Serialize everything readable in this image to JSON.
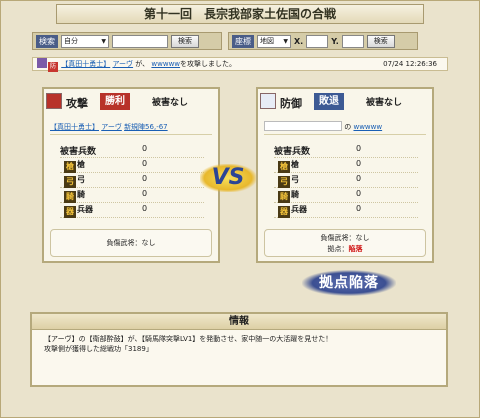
{
  "title": "第十一回　長宗我部家土佐国の合戦",
  "search_left": {
    "label": "検索",
    "select": "自分",
    "button": "検索"
  },
  "search_right": {
    "label": "座標",
    "select": "地図",
    "x_label": "X.",
    "y_label": "Y.",
    "button": "検索"
  },
  "report": {
    "badge": "防",
    "unit_tag": "【真田十勇士】",
    "player": "アーヴ",
    "particle": "が、",
    "target": "wwwww",
    "message": "を攻撃しました。",
    "time": "07/24 12:26:36"
  },
  "attack": {
    "label": "攻撃",
    "result": "勝利",
    "damage": "被害なし",
    "unit_tag": "【真田十勇士】",
    "player": "アーヴ",
    "location": "新規陣56,-67",
    "header": "被害兵数",
    "header_value": "0",
    "rows": [
      {
        "icon": "槍",
        "label": "槍",
        "value": "0"
      },
      {
        "icon": "弓",
        "label": "弓",
        "value": "0"
      },
      {
        "icon": "騎",
        "label": "騎",
        "value": "0"
      },
      {
        "icon": "器",
        "label": "兵器",
        "value": "0"
      }
    ],
    "wounded": "負傷武将：なし"
  },
  "defense": {
    "label": "防御",
    "result": "敗退",
    "damage": "被害なし",
    "particle": "の",
    "player": "wwwww",
    "header": "被害兵数",
    "header_value": "0",
    "rows": [
      {
        "icon": "槍",
        "label": "槍",
        "value": "0"
      },
      {
        "icon": "弓",
        "label": "弓",
        "value": "0"
      },
      {
        "icon": "騎",
        "label": "騎",
        "value": "0"
      },
      {
        "icon": "器",
        "label": "兵器",
        "value": "0"
      }
    ],
    "wounded": "負傷武将：なし",
    "base_label": "拠点：",
    "base_status": "陥落"
  },
  "vs": "VS",
  "stamp": "拠点陥落",
  "info": {
    "title": "情報",
    "line1": "【アーヴ】の【衛部酔鼓】が、【騎馬隊突撃LV1】を発動させ、家中随一の大活躍を見せた！",
    "line2": "攻撃側が獲得した総戦功「3189」"
  },
  "colors": {
    "win": "#c0392b",
    "lose": "#3d5a94",
    "accent": "#4a5d88"
  }
}
